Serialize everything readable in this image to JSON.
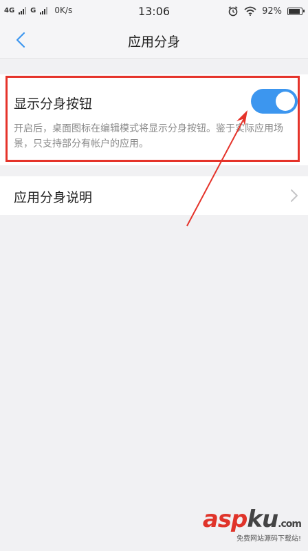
{
  "status_bar": {
    "network1": "4G",
    "network2": "G",
    "speed": "0K/s",
    "time": "13:06",
    "battery": "92%",
    "battery_level": 0.92
  },
  "header": {
    "title": "应用分身"
  },
  "setting": {
    "title": "显示分身按钮",
    "toggle_on": true,
    "description": "开启后，桌面图标在编辑模式将显示分身按钮。鉴于实际应用场景，只支持部分有帐户的应用。"
  },
  "info_row": {
    "label": "应用分身说明"
  },
  "watermark": {
    "brand_red": "asp",
    "brand_dark": "ku",
    "brand_suffix": ".com",
    "tagline": "免费网站源码下载站!"
  },
  "colors": {
    "accent": "#3c96ef",
    "highlight": "#e5332a",
    "background": "#f1f1f3"
  }
}
